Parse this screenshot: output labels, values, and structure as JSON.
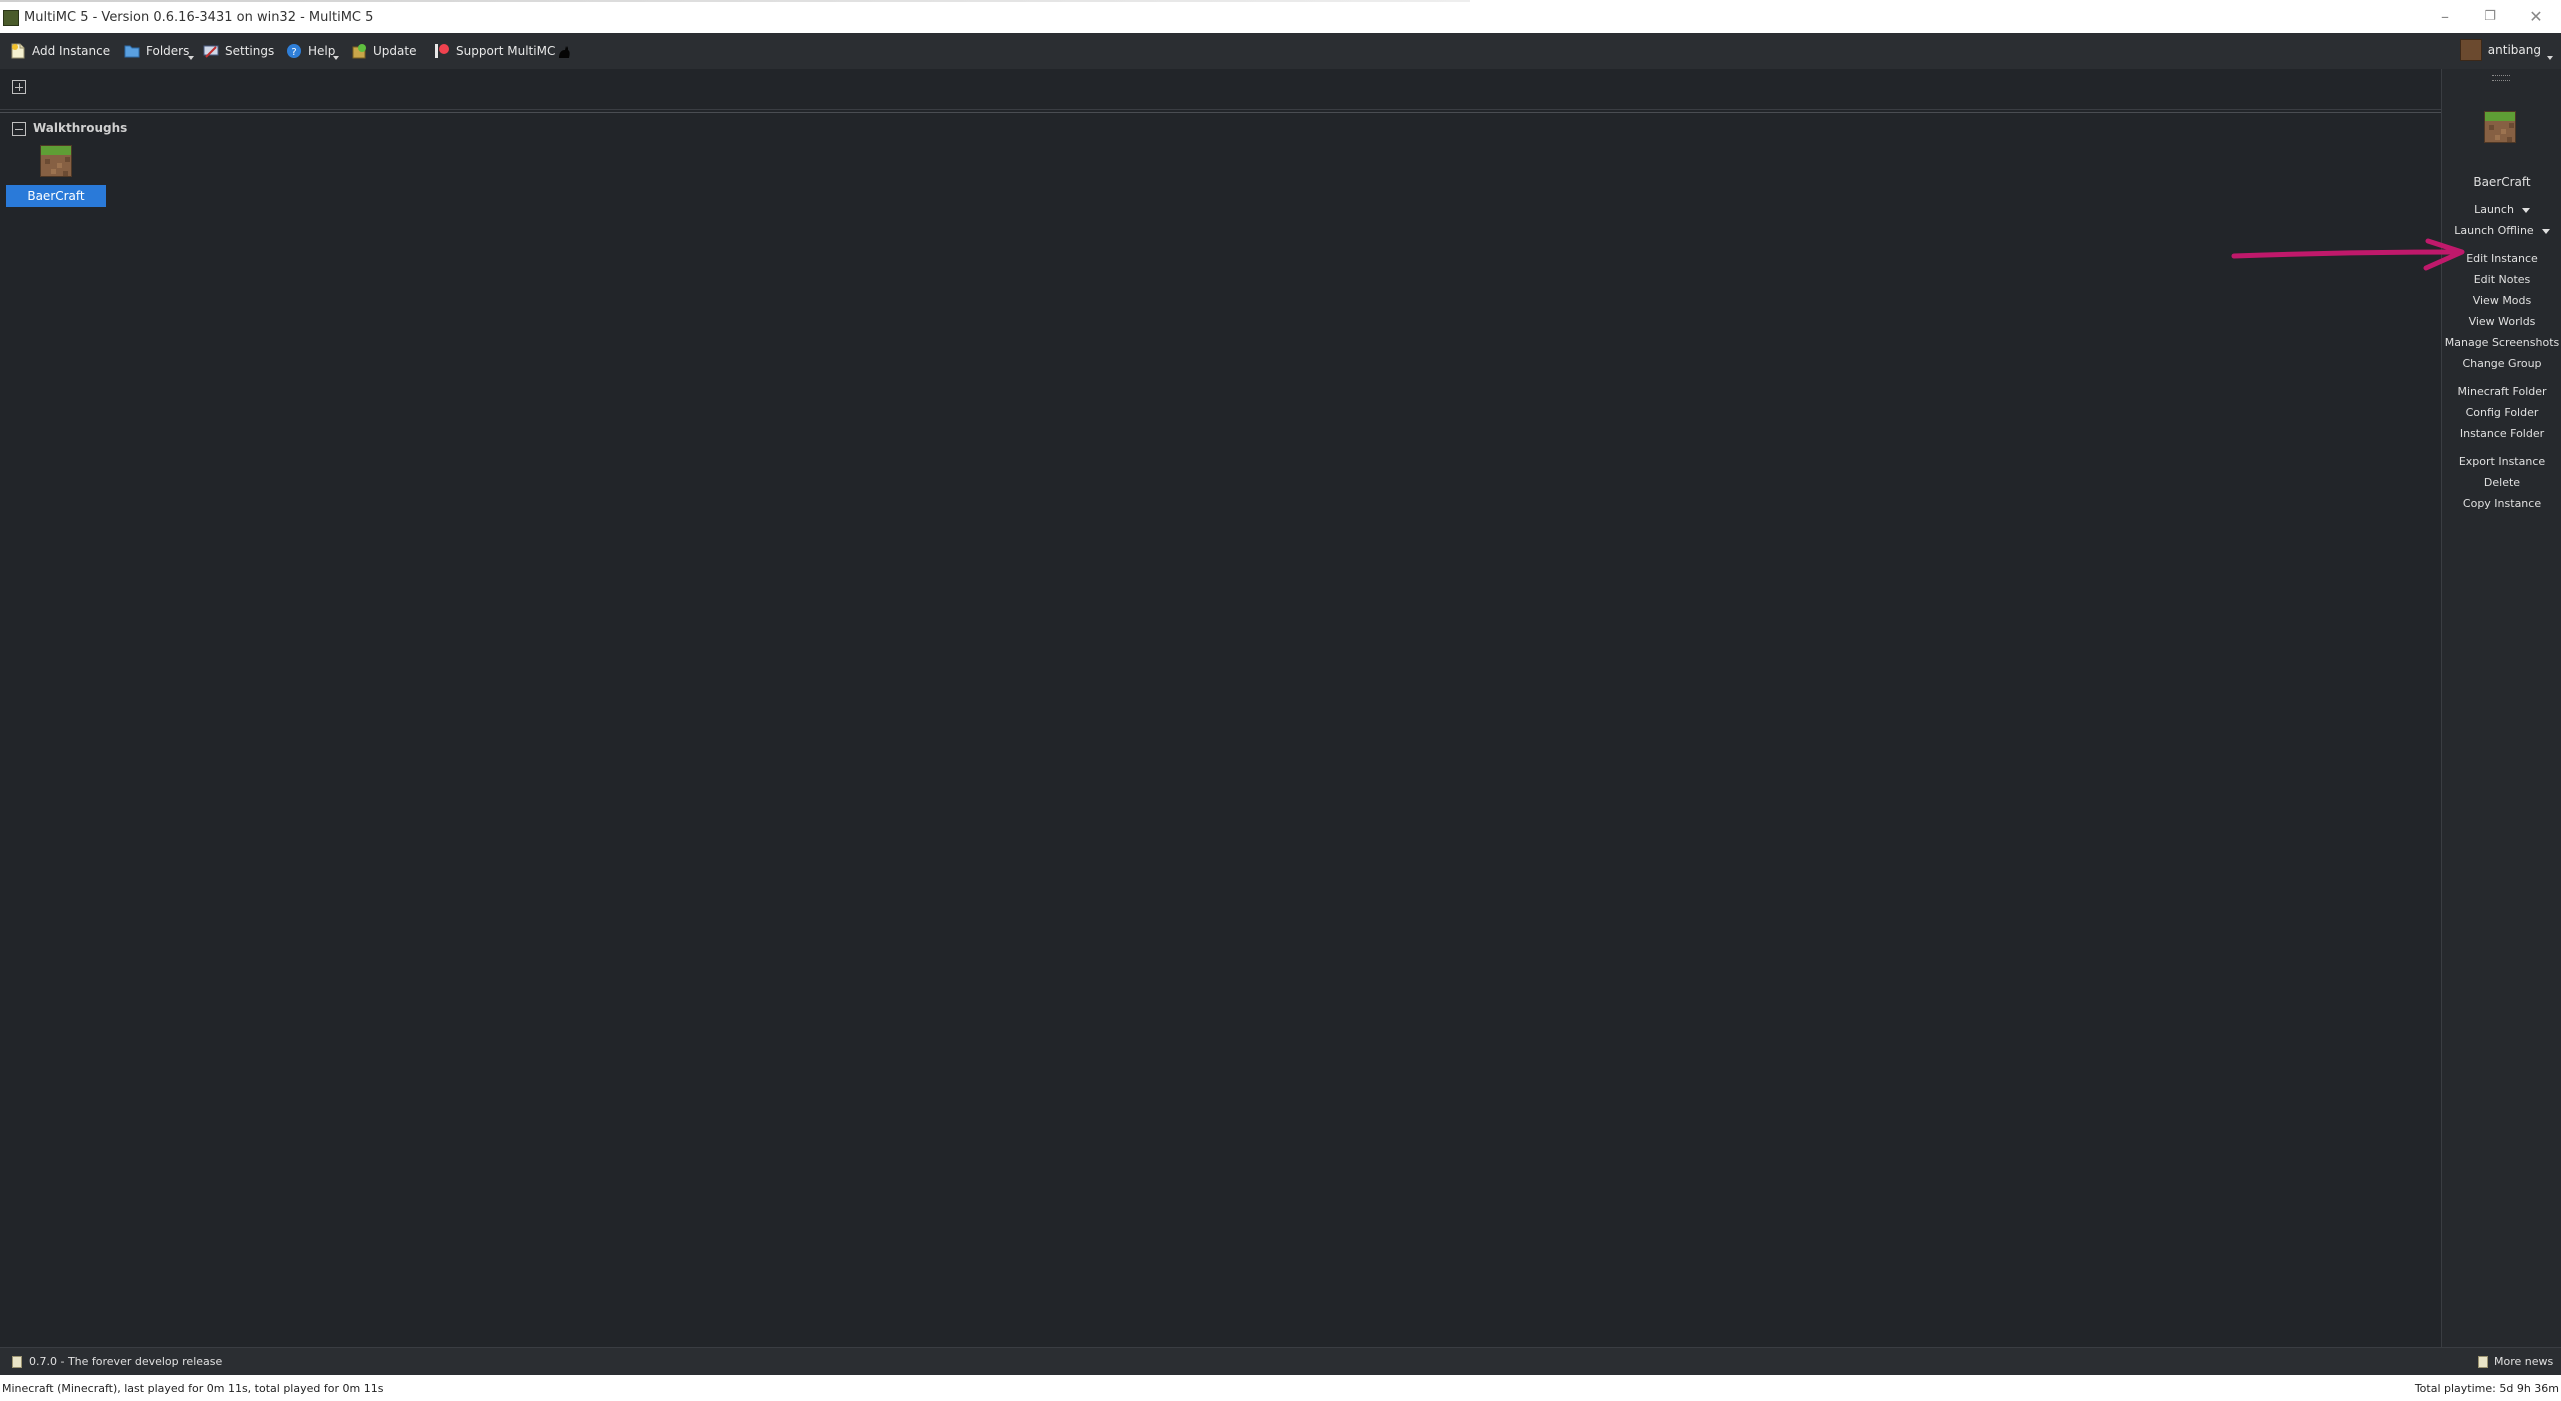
{
  "window": {
    "title": "MultiMC 5 - Version 0.6.16-3431 on win32 - MultiMC 5",
    "minimize": "–",
    "restore": "❐",
    "close": "✕"
  },
  "toolbar": {
    "add_instance": "Add Instance",
    "folders": "Folders",
    "settings": "Settings",
    "help": "Help",
    "update": "Update",
    "support": "Support MultiMC",
    "username": "antibang"
  },
  "main": {
    "group_title": "Walkthroughs",
    "instances": [
      {
        "label": "BaerCraft"
      }
    ]
  },
  "side_panel": {
    "instance_name": "BaerCraft",
    "launch": "Launch",
    "launch_offline": "Launch Offline",
    "edit_instance": "Edit Instance",
    "edit_notes": "Edit Notes",
    "view_mods": "View Mods",
    "view_worlds": "View Worlds",
    "manage_screenshots": "Manage Screenshots",
    "change_group": "Change Group",
    "minecraft_folder": "Minecraft Folder",
    "config_folder": "Config Folder",
    "instance_folder": "Instance Folder",
    "export_instance": "Export Instance",
    "delete": "Delete",
    "copy_instance": "Copy Instance"
  },
  "news": {
    "headline": "0.7.0 - The forever develop release",
    "more_news": "More news"
  },
  "status": {
    "left": "Minecraft  (Minecraft), last played for 0m 11s, total played for 0m 11s",
    "right": "Total playtime: 5d 9h 36m"
  },
  "colors": {
    "selection": "#2a7ad9",
    "annotation_arrow": "#c0196b",
    "background": "#222529"
  }
}
